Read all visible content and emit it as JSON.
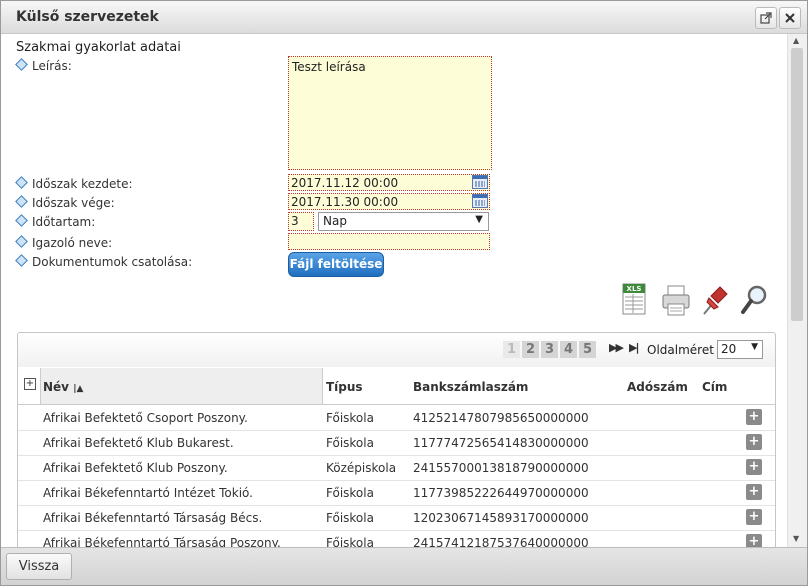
{
  "dialog": {
    "title": "Külső szervezetek",
    "popout_icon": "popout-icon",
    "close_icon": "close-icon"
  },
  "form": {
    "section_title": "Szakmai gyakorlat adatai",
    "labels": {
      "description": "Leírás:",
      "period_start": "Időszak kezdete:",
      "period_end": "Időszak vége:",
      "duration": "Időtartam:",
      "certifier_name": "Igazoló neve:",
      "attach_documents": "Dokumentumok csatolása:"
    },
    "values": {
      "description": "Teszt leírása",
      "period_start": "2017.11.12 00:00",
      "period_end": "2017.11.30 00:00",
      "duration": "3",
      "duration_unit": "Nap",
      "certifier_name": ""
    },
    "upload_button": "Fájl feltöltése"
  },
  "toolbar": {
    "icons": [
      "xls-export-icon",
      "print-icon",
      "pin-icon",
      "search-icon"
    ],
    "xls_text": "XLS"
  },
  "grid": {
    "pager": {
      "pages": [
        "1",
        "2",
        "3",
        "4",
        "5"
      ],
      "current_page": "1",
      "next_label": "»",
      "last_label": "»|",
      "page_size_label": "Oldalméret",
      "page_size": "20"
    },
    "columns": {
      "expand": "+",
      "name": "Név",
      "type": "Típus",
      "bank_account": "Bankszámlaszám",
      "tax_number": "Adószám",
      "address": "Cím"
    },
    "rows": [
      {
        "name": "Afrikai Befektető Csoport Poszony.",
        "type": "Főiskola",
        "bank_account": "41252147807985650000000",
        "tax_number": "",
        "address": ""
      },
      {
        "name": "Afrikai Befektető Klub Bukarest.",
        "type": "Főiskola",
        "bank_account": "11777472565414830000000",
        "tax_number": "",
        "address": ""
      },
      {
        "name": "Afrikai Befektető Klub Poszony.",
        "type": "Középiskola",
        "bank_account": "24155700013818790000000",
        "tax_number": "",
        "address": ""
      },
      {
        "name": "Afrikai Békefenntartó Intézet Tokió.",
        "type": "Főiskola",
        "bank_account": "11773985222644970000000",
        "tax_number": "",
        "address": ""
      },
      {
        "name": "Afrikai Békefenntartó Társaság Bécs.",
        "type": "Főiskola",
        "bank_account": "12023067145893170000000",
        "tax_number": "",
        "address": ""
      },
      {
        "name": "Afrikai Békefenntartó Társaság Poszony.",
        "type": "Főiskola",
        "bank_account": "24157412187537640000000",
        "tax_number": "",
        "address": ""
      }
    ],
    "row_action_icon": "+"
  },
  "footer": {
    "back_button": "Vissza"
  }
}
